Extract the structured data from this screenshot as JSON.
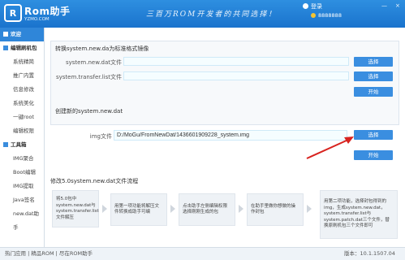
{
  "header": {
    "logo_mark": "R",
    "logo_text": "Rom助手",
    "logo_sub": "YZMO.COM",
    "slogan": "三百万ROM开发者的共同选择！",
    "login": "登录",
    "account": "8888888",
    "min": "—",
    "close": "×",
    "colors": {
      "bar": "#1e7fd6",
      "accent": "#3a8ee0"
    }
  },
  "sidebar": {
    "welcome": "欢迎",
    "edit_group": "编辑刷机包",
    "edit_items": [
      "系统精简",
      "推广内置",
      "信息修改",
      "系统美化",
      "一键root",
      "编辑权限"
    ],
    "tools_group": "工具箱",
    "tool_items": [
      "IMG聚合",
      "Boot编辑",
      "IMG提取",
      "Java签名",
      "new.dat助手"
    ]
  },
  "convert": {
    "title": "转换system.new.da为标准格式镜像",
    "dat_label": "system.new.dat文件",
    "dat_value": "",
    "list_label": "system.transfer.list文件",
    "list_value": "",
    "select": "选择",
    "start": "开始"
  },
  "create": {
    "title": "创建新的system.new.dat",
    "img_label": "img文件",
    "img_value": "D:/MoGu/FromNewDat/1436601909228_system.img",
    "select": "选择",
    "start": "开始"
  },
  "flow": {
    "title": "修改5.0system.new.dat文件流程",
    "steps": [
      "将5.0包中system.new.dat与system.transfer.list文件解压",
      "用第一项功能将解压文件转换成助手可编",
      "点击助手左侧编辑权限选择刚刚生成的包",
      "在助手里做你想做的操作封包",
      "用第二项功能，选择封包得到的img，生成system.new.dat，system.transfer.list与system.patch.dat三个文件，替换原刷机包三个文件即可"
    ]
  },
  "footer": {
    "left": "热门应用 | 精品ROM | 尽在ROM助手",
    "version": "版本：10.1.1507.04"
  }
}
